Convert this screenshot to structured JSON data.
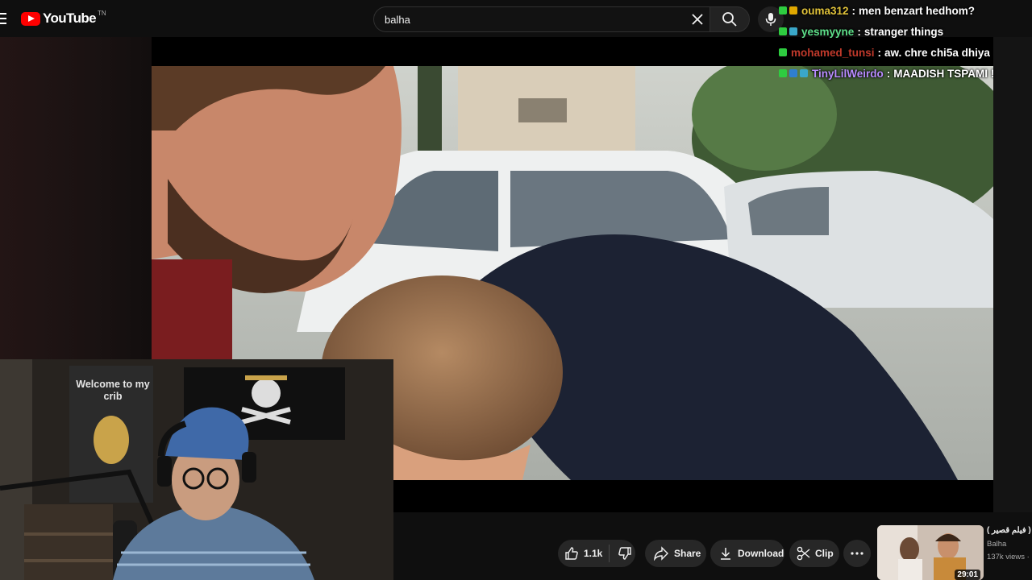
{
  "app": {
    "logo_text": "YouTube",
    "logo_superscript": "TN"
  },
  "search": {
    "value": "balha"
  },
  "icons": [
    "menu-icon",
    "youtube-logo-icon",
    "clear-icon",
    "search-icon",
    "mic-icon",
    "like-icon",
    "dislike-icon",
    "share-icon",
    "download-icon",
    "clip-icon",
    "more-icon"
  ],
  "chat": [
    {
      "user": "ouma312",
      "user_color": "#e0c23a",
      "message": "men benzart hedhom?"
    },
    {
      "user": "yesmyyne",
      "user_color": "#5ee08a",
      "message": "stranger things"
    },
    {
      "user": "mohamed_tunsi",
      "user_color": "#c0392b",
      "message": "aw. chre chi5a dhiya"
    },
    {
      "user": "TinyLilWeirdo",
      "user_color": "#b98cff",
      "message": "MAADISH TSPAMI !"
    }
  ],
  "webcam": {
    "poster_text": "Welcome to my crib"
  },
  "actions": {
    "likes": "1.1k",
    "share_label": "Share",
    "download_label": "Download",
    "clip_label": "Clip"
  },
  "recommendation": {
    "title": "( فيلم قصير ) ",
    "channel": "Balha",
    "views": "137k views ·",
    "duration": "29:01"
  }
}
